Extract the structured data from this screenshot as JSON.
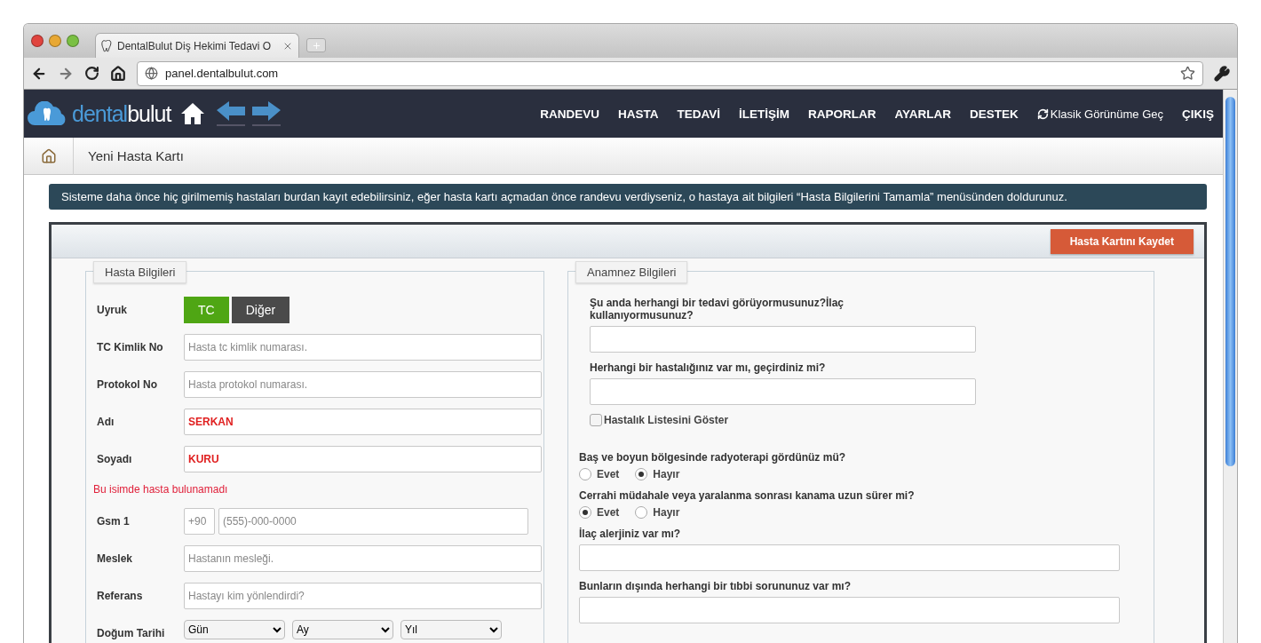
{
  "browser": {
    "tab_title": "DentalBulut Diş Hekimi Tedavi O",
    "url": "panel.dentalbulut.com"
  },
  "logo": {
    "part1": "dental",
    "part2": "bulut"
  },
  "nav": [
    {
      "label": "RANDEVU",
      "kind": "link"
    },
    {
      "label": "HASTA",
      "kind": "link"
    },
    {
      "label": "TEDAVİ",
      "kind": "link"
    },
    {
      "label": "İLETİŞİM",
      "kind": "link"
    },
    {
      "label": "RAPORLAR",
      "kind": "link"
    },
    {
      "label": "AYARLAR",
      "kind": "link"
    },
    {
      "label": "DESTEK",
      "kind": "link"
    },
    {
      "label": "Klasik Görünüme Geç",
      "kind": "switch"
    },
    {
      "label": "ÇIKIŞ",
      "kind": "link"
    }
  ],
  "breadcrumb": "Yeni Hasta Kartı",
  "info": "Sisteme daha önce hiç girilmemiş hastaları burdan kayıt edebilirsiniz, eğer hasta kartı açmadan önce randevu verdiyseniz, o hastaya ait bilgileri “Hasta Bilgilerini Tamamla” menüsünden doldurunuz.",
  "save_button": "Hasta Kartını Kaydet",
  "patient": {
    "legend": "Hasta Bilgileri",
    "uyruk": {
      "label": "Uyruk",
      "options": [
        {
          "label": "TC",
          "selected": true
        },
        {
          "label": "Diğer",
          "selected": false
        }
      ]
    },
    "fields": [
      {
        "label": "TC Kimlik No",
        "placeholder": "Hasta tc kimlik numarası."
      },
      {
        "label": "Protokol No",
        "placeholder": "Hasta protokol numarası."
      },
      {
        "label": "Adı",
        "value": "SERKAN"
      },
      {
        "label": "Soyadı",
        "value": "KURU"
      }
    ],
    "error": "Bu isimde hasta bulunamadı",
    "gsm": {
      "label": "Gsm 1",
      "prefix": "+90",
      "placeholder": "(555)-000-0000"
    },
    "fields2": [
      {
        "label": "Meslek",
        "placeholder": "Hastanın mesleği."
      },
      {
        "label": "Referans",
        "placeholder": "Hastayı kim yönlendirdi?"
      }
    ],
    "birth": {
      "label": "Doğum Tarihi",
      "selects": [
        "Gün",
        "Ay",
        "Yıl"
      ]
    }
  },
  "anamnez": {
    "legend": "Anamnez Bilgileri",
    "items": [
      {
        "kind": "short_input",
        "question": "Şu anda herhangi bir tedavi görüyormusunuz?İlaç kullanıyormusunuz?"
      },
      {
        "kind": "short_input",
        "question": "Herhangi bir hastalığınız var mı, geçirdiniz mi?"
      },
      {
        "kind": "checkbox",
        "label": "Hastalık Listesini Göster",
        "checked": false
      },
      {
        "kind": "radio",
        "question": "Baş ve boyun bölgesinde radyoterapi gördünüz mü?",
        "options": [
          {
            "label": "Evet",
            "selected": false
          },
          {
            "label": "Hayır",
            "selected": true
          }
        ]
      },
      {
        "kind": "radio",
        "question": "Cerrahi müdahale veya yaralanma sonrası kanama uzun sürer mi?",
        "options": [
          {
            "label": "Evet",
            "selected": true
          },
          {
            "label": "Hayır",
            "selected": false
          }
        ]
      },
      {
        "kind": "long_input",
        "question": "İlaç alerjiniz var mı?"
      },
      {
        "kind": "long_input",
        "question": "Bunların dışında herhangi bir tıbbi sorununuz var mı?"
      }
    ]
  }
}
